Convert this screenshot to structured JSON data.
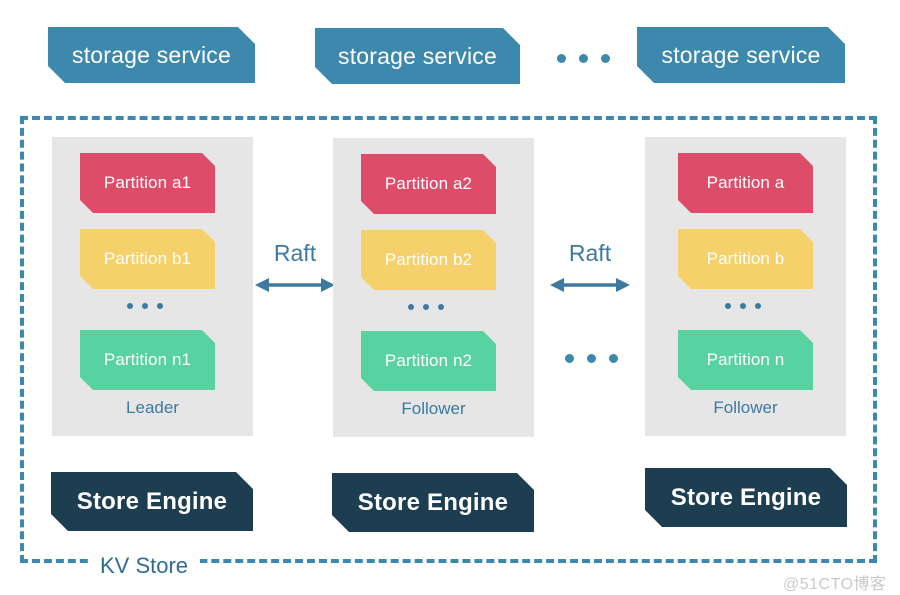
{
  "diagram": {
    "title": "KV Store",
    "watermark": "@51CTO博客",
    "colors": {
      "storage_service": "#3d89ae",
      "store_engine": "#1d3d51",
      "panel": "#e6e6e6",
      "partition_a": "#dd4d6a",
      "partition_b": "#f6d06a",
      "partition_n": "#57d2a0",
      "accent_text": "#3d7aa0",
      "dashed_border": "#3d89ae"
    }
  },
  "storage_services": [
    {
      "label": "storage service"
    },
    {
      "label": "storage service"
    },
    {
      "label": "storage service"
    }
  ],
  "top_ellipsis": {
    "label": "..."
  },
  "nodes": [
    {
      "role": "Leader",
      "engine": "Store Engine",
      "partitions": [
        {
          "label": "Partition a1",
          "color": "#dd4d6a"
        },
        {
          "label": "Partition b1",
          "color": "#f6d06a"
        },
        {
          "label": "Partition n1",
          "color": "#57d2a0"
        }
      ],
      "ellipsis": "..."
    },
    {
      "role": "Follower",
      "engine": "Store Engine",
      "partitions": [
        {
          "label": "Partition a2",
          "color": "#dd4d6a"
        },
        {
          "label": "Partition b2",
          "color": "#f6d06a"
        },
        {
          "label": "Partition n2",
          "color": "#57d2a0"
        }
      ],
      "ellipsis": "..."
    },
    {
      "role": "Follower",
      "engine": "Store Engine",
      "partitions": [
        {
          "label": "Partition a",
          "color": "#dd4d6a"
        },
        {
          "label": "Partition b",
          "color": "#f6d06a"
        },
        {
          "label": "Partition n",
          "color": "#57d2a0"
        }
      ],
      "ellipsis": "..."
    }
  ],
  "connectors": [
    {
      "label": "Raft"
    },
    {
      "label": "Raft"
    }
  ],
  "node_ellipsis": {
    "label": "..."
  }
}
